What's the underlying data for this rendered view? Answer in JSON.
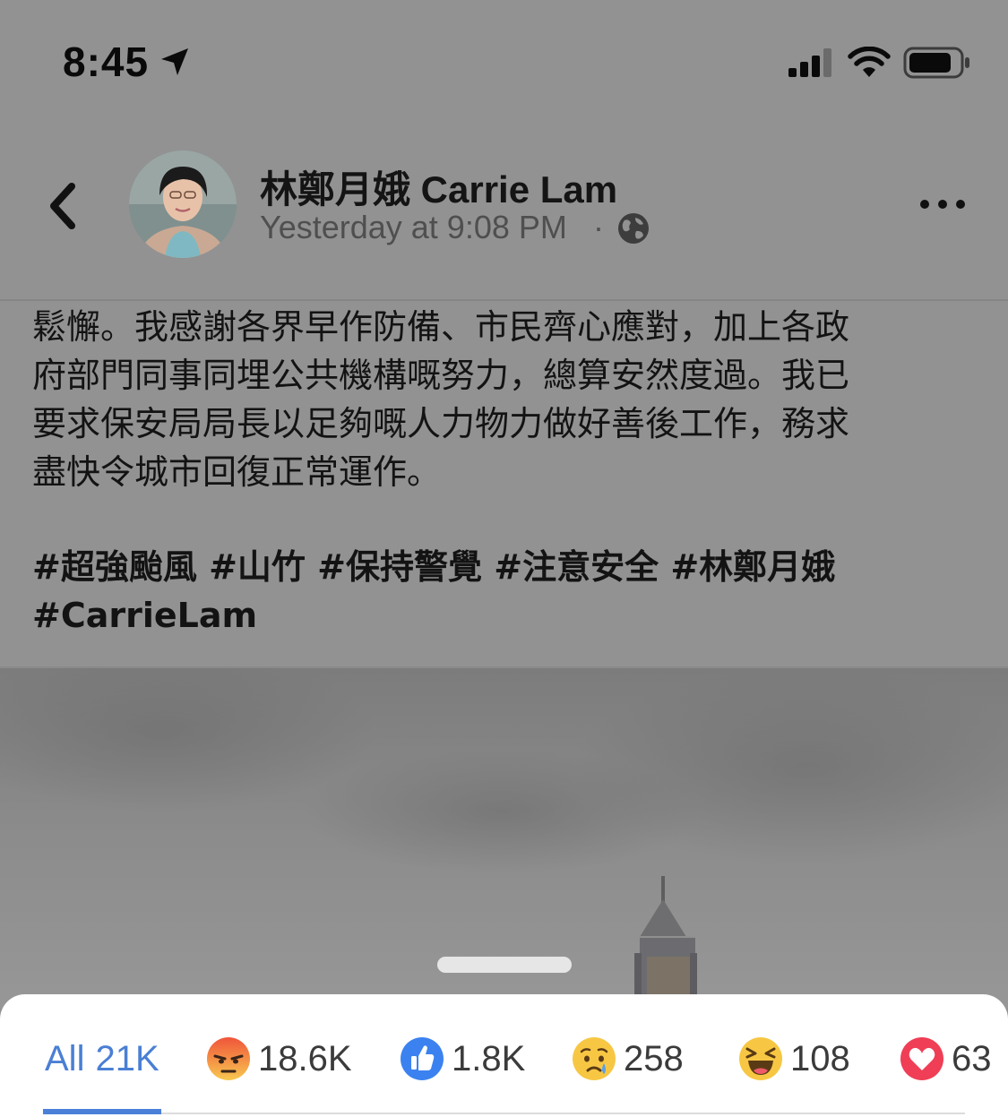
{
  "status_bar": {
    "time": "8:45",
    "icons": [
      "location-arrow-icon",
      "cellular-signal-icon",
      "wifi-icon",
      "battery-icon"
    ]
  },
  "post": {
    "author": "林鄭月娥 Carrie Lam",
    "timestamp": "Yesterday at 9:08 PM",
    "separator": "·",
    "privacy_icon": "globe-icon",
    "body_lines": [
      "鬆懈。我感謝各界早作防備、市民齊心應對，加上各政",
      "府部門同事同埋公共機構嘅努力，總算安然度過。我已",
      "要求保安局局長以足夠嘅人力物力做好善後工作，務求",
      "盡快令城市回復正常運作。"
    ],
    "hashtags": [
      "#超強颱風",
      "#山竹",
      "#保持警覺",
      "#注意安全",
      "#林鄭月娥",
      "#CarrieLam"
    ]
  },
  "reactions": {
    "all": {
      "label": "All",
      "count": "21K"
    },
    "items": [
      {
        "type": "angry",
        "count": "18.6K",
        "icon": "angry-emoji-icon",
        "color": "#f25f36"
      },
      {
        "type": "like",
        "count": "1.8K",
        "icon": "like-icon",
        "color": "#3b82f0"
      },
      {
        "type": "sad",
        "count": "258",
        "icon": "sad-emoji-icon",
        "color": "#f7c744"
      },
      {
        "type": "haha",
        "count": "108",
        "icon": "haha-emoji-icon",
        "color": "#f7c744"
      },
      {
        "type": "love",
        "count": "63",
        "icon": "love-icon",
        "color": "#ef3e55"
      }
    ]
  },
  "colors": {
    "active_tab": "#4a7fd4",
    "dim_background": "#929292"
  }
}
